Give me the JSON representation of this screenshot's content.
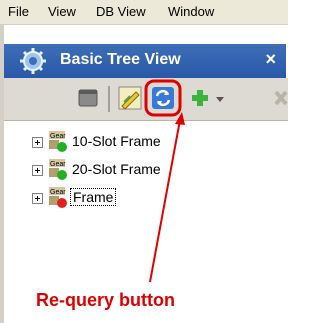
{
  "menubar": {
    "items": [
      {
        "label": "File"
      },
      {
        "label": "View"
      },
      {
        "label": "DB View"
      },
      {
        "label": "Window"
      }
    ]
  },
  "panel": {
    "title": "Basic Tree View",
    "close_glyph": "×",
    "icon": "gear-icon"
  },
  "toolbar": {
    "buttons": [
      {
        "name": "view-icon"
      },
      {
        "name": "edit-icon"
      },
      {
        "name": "refresh-icon",
        "highlighted": true
      },
      {
        "name": "add-icon"
      },
      {
        "name": "dropdown-arrow-icon"
      }
    ]
  },
  "tree": {
    "items": [
      {
        "icon_text": "Gear",
        "label": "10-Slot Frame",
        "status": "green"
      },
      {
        "icon_text": "Gear",
        "label": "20-Slot Frame",
        "status": "green"
      },
      {
        "icon_text": "Gear",
        "label": "Frame",
        "status": "red",
        "selected": true
      }
    ]
  },
  "annotation": {
    "text": "Re-query button",
    "color": "#e00000"
  }
}
